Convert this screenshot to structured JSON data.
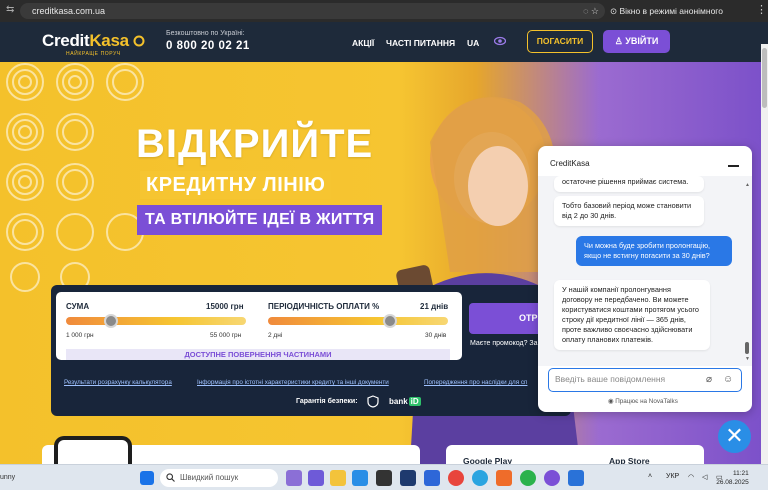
{
  "browser": {
    "url": "creditkasa.com.ua",
    "incognito_label": "Вікно в режимі анонімного перегляду"
  },
  "header": {
    "logo_text_a": "Credit",
    "logo_text_b": "Kasa",
    "logo_sub": "НАЙКРАЩЕ ПОРУЧ",
    "hotline_label": "Безкоштовно по Україні:",
    "hotline": "0 800 20 02 21",
    "nav": [
      "АКЦІЇ",
      "ЧАСТІ ПИТАННЯ",
      "UA"
    ],
    "repay_button": "ПОГАСИТИ",
    "login_button": "УВІЙТИ"
  },
  "hero": {
    "line1": "ВІДКРИЙТЕ",
    "line2": "КРЕДИТНУ ЛІНІЮ",
    "line3": "ТА ВТІЛЮЙТЕ ІДЕЇ В ЖИТТЯ"
  },
  "calculator": {
    "sum_label": "СУМА",
    "sum_value": "15000 грн",
    "sum_min": "1 000 грн",
    "sum_max": "55 000 грн",
    "sum_level": 0.25,
    "period_label": "ПЕРІОДИЧНІСТЬ ОПЛАТИ %",
    "period_value": "21 днів",
    "period_min": "2 дні",
    "period_max": "30 днів",
    "period_level": 0.68,
    "partial_repay": "ДОСТУПНЕ ПОВЕРНЕННЯ ЧАСТИНАМИ",
    "get_button": "ОТРИ",
    "promo": "Маєте промокод? За",
    "links": [
      "Результати розрахунку калькулятора",
      "Інформація про істотні характеристики кредиту та інші документи",
      "Попередження про наслідки для сп"
    ],
    "guarantee": "Гарантія безпеки:",
    "bankid_a": "bank",
    "bankid_b": "iD"
  },
  "stores": {
    "google": "Google Play",
    "apple": "App Store"
  },
  "chat": {
    "title": "CreditKasa",
    "messages": [
      {
        "from": "in",
        "text": "остаточне рішення приймає система."
      },
      {
        "from": "in",
        "text": "Тобто базовий період може становити від 2 до 30 днів."
      },
      {
        "from": "out",
        "text": "Чи можна буде зробити пролонгацію, якщо не встигну погасити за 30 днів?"
      },
      {
        "from": "in",
        "text": "У нашій компанії пролонгування договору не передбачено. Ви можете користуватися коштами протягом усього строку дії кредитної лінії — 365 днів, проте важливо своєчасно здійснювати оплату планових платежів."
      }
    ],
    "input_placeholder": "Введіть ваше повідомлення",
    "powered": "Працює на NovaTalks"
  },
  "taskbar": {
    "weather": "unny",
    "search_placeholder": "Швидкий пошук",
    "lang": "УКР",
    "time": "11:21",
    "date": "26.08.2025"
  },
  "colors": {
    "brand_yellow": "#f4c12b",
    "brand_purple": "#7b4fd6",
    "header_navy": "#1e2a3a",
    "chat_blue": "#2a78e6"
  }
}
